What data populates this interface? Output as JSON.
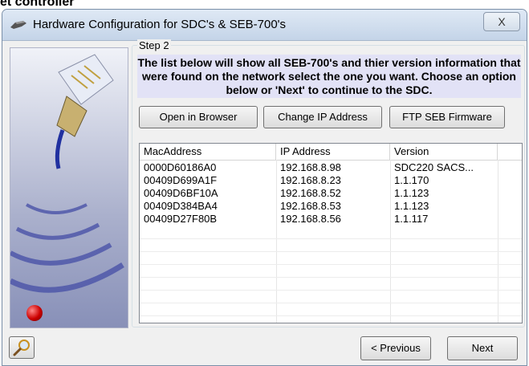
{
  "page_heading_fragment": "et controller",
  "window": {
    "title": "Hardware Configuration for SDC's & SEB-700's",
    "close_glyph": "X"
  },
  "step": {
    "label": "Step 2",
    "description": "The list below will show all SEB-700's and thier version information that were found on the network select the one you want. Choose an option below or 'Next' to continue to the SDC."
  },
  "actions": {
    "open_browser": "Open in Browser",
    "change_ip": "Change IP Address",
    "ftp_firmware": "FTP SEB Firmware"
  },
  "table": {
    "columns": [
      "MacAddress",
      "IP Address",
      "Version"
    ],
    "rows": [
      [
        "0000D60186A0",
        "192.168.8.98",
        "SDC220 SACS..."
      ],
      [
        "00409D699A1F",
        "192.168.8.23",
        "1.1.170"
      ],
      [
        "00409D6BF10A",
        "192.168.8.52",
        "1.1.123"
      ],
      [
        "00409D384BA4",
        "192.168.8.53",
        "1.1.123"
      ],
      [
        "00409D27F80B",
        "192.168.8.56",
        "1.1.117"
      ]
    ]
  },
  "nav": {
    "previous": "< Previous",
    "next": "Next"
  },
  "icons": {
    "title": "network-plug-icon",
    "search": "magnifier-icon"
  },
  "colors": {
    "description_bg": "#e2e2f6",
    "wave": "#4a52a8"
  }
}
